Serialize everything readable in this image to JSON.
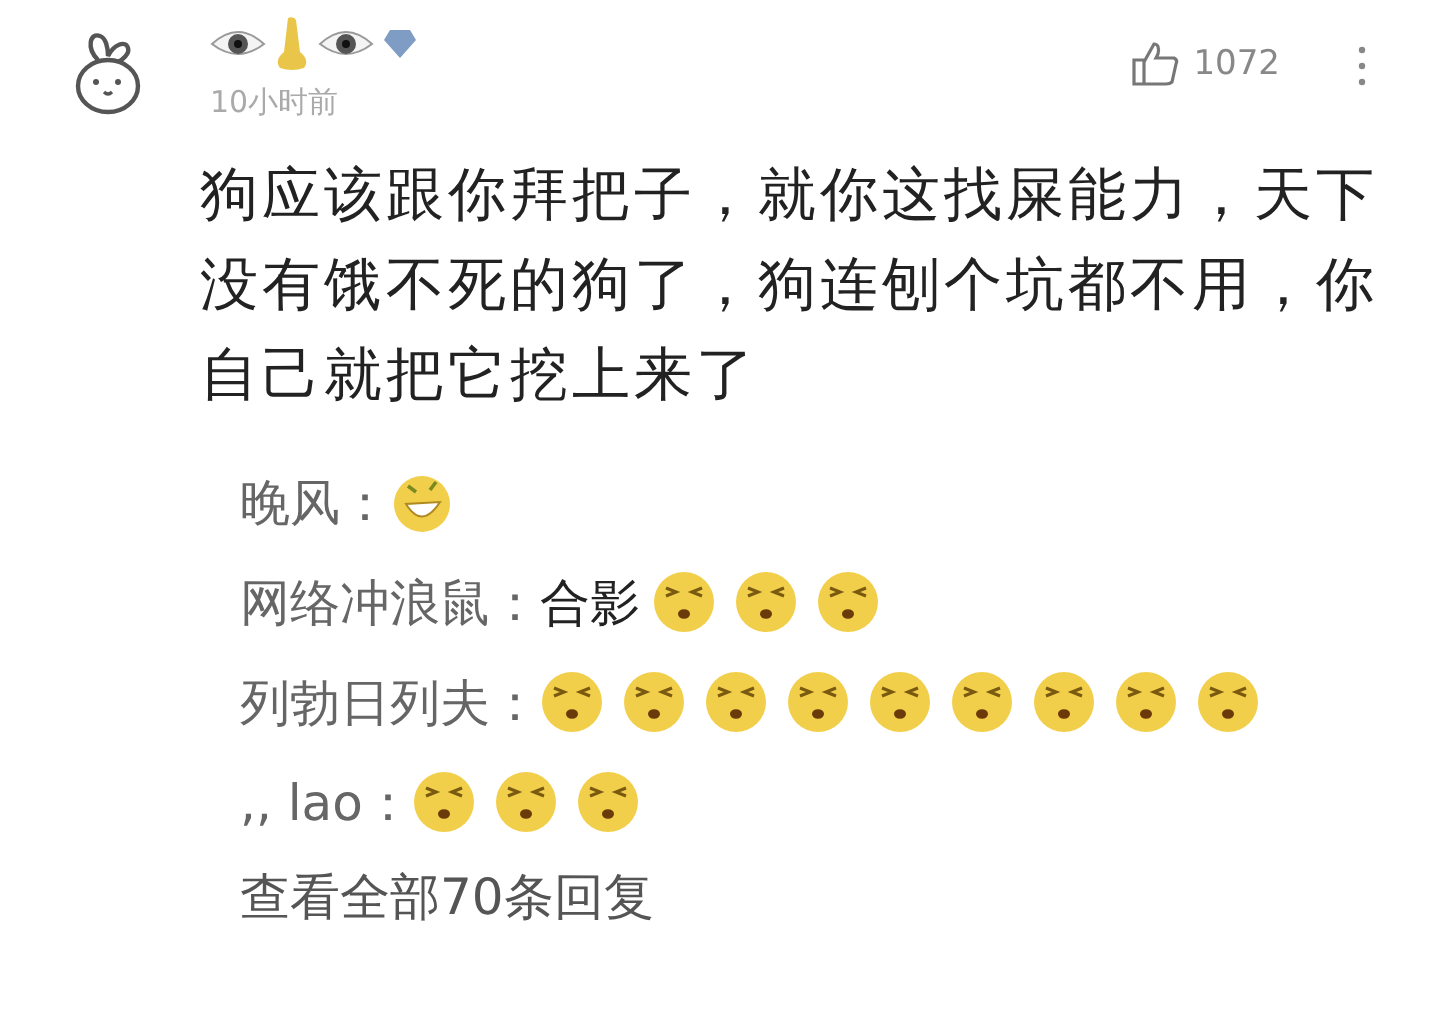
{
  "comment": {
    "time": "10小时前",
    "likes": "1072",
    "text": "狗应该跟你拜把子，就你这找屎能力，天下没有饿不死的狗了，狗连刨个坑都不用，你自己就把它挖上来了"
  },
  "replies": [
    {
      "name": "晚风：",
      "parts": [
        {
          "kind": "laugh"
        }
      ]
    },
    {
      "name": "网络冲浪鼠：",
      "parts": [
        {
          "kind": "text",
          "text": "合影"
        },
        {
          "kind": "squint"
        },
        {
          "kind": "squint"
        },
        {
          "kind": "squint"
        }
      ]
    },
    {
      "name": "列勃日列夫：",
      "parts": [
        {
          "kind": "squint"
        },
        {
          "kind": "squint"
        },
        {
          "kind": "squint"
        },
        {
          "kind": "squint"
        },
        {
          "kind": "squint"
        },
        {
          "kind": "squint"
        },
        {
          "kind": "squint"
        },
        {
          "kind": "squint"
        },
        {
          "kind": "squint"
        }
      ]
    },
    {
      "name": ",, lao：",
      "parts": [
        {
          "kind": "squint"
        },
        {
          "kind": "squint"
        },
        {
          "kind": "squint"
        }
      ]
    }
  ],
  "view_all": "查看全部70条回复"
}
